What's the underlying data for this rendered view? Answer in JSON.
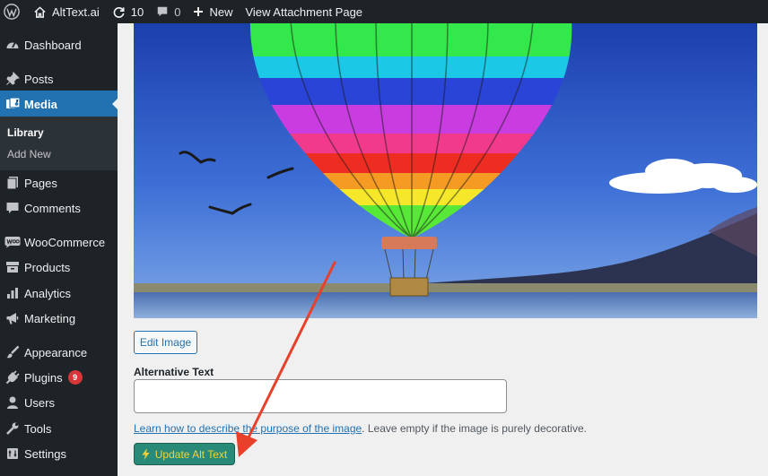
{
  "admin_bar": {
    "site_name": "AltText.ai",
    "updates_count": "10",
    "comments_count": "0",
    "new_label": "New",
    "view_attachment_label": "View Attachment Page"
  },
  "sidebar": {
    "items": [
      {
        "label": "Dashboard",
        "icon": "dashboard-icon"
      },
      {
        "label": "Posts",
        "icon": "pin-icon"
      },
      {
        "label": "Media",
        "icon": "media-icon"
      },
      {
        "label": "Pages",
        "icon": "pages-icon"
      },
      {
        "label": "Comments",
        "icon": "comment-icon"
      },
      {
        "label": "WooCommerce",
        "icon": "woo-icon"
      },
      {
        "label": "Products",
        "icon": "archive-icon"
      },
      {
        "label": "Analytics",
        "icon": "bar-chart-icon"
      },
      {
        "label": "Marketing",
        "icon": "megaphone-icon"
      },
      {
        "label": "Appearance",
        "icon": "paintbrush-icon"
      },
      {
        "label": "Plugins",
        "icon": "plug-icon",
        "badge": "9"
      },
      {
        "label": "Users",
        "icon": "user-icon"
      },
      {
        "label": "Tools",
        "icon": "wrench-icon"
      },
      {
        "label": "Settings",
        "icon": "settings-icon"
      }
    ],
    "media_submenu": [
      {
        "label": "Library"
      },
      {
        "label": "Add New"
      }
    ]
  },
  "main": {
    "edit_image_label": "Edit Image",
    "alt_text_label": "Alternative Text",
    "alt_text_value": "",
    "help_link_text": "Learn how to describe the purpose of the image",
    "help_suffix_text": ". Leave empty if the image is purely decorative.",
    "update_button_label": "Update Alt Text"
  },
  "colors": {
    "admin_dark": "#1d2327",
    "active_blue": "#2271b1",
    "update_button_bg": "#2a8a78",
    "update_button_text": "#f2d23a",
    "annotation_arrow": "#e8402a"
  }
}
